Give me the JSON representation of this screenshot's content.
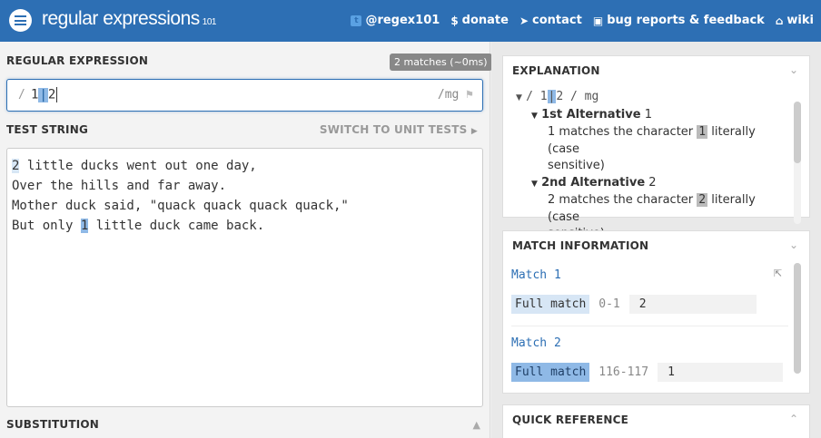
{
  "header": {
    "logo_main": "regular expressions",
    "logo_sub": "101",
    "nav": [
      {
        "icon": "twitter-icon",
        "label": "@regex101"
      },
      {
        "icon": "dollar-icon",
        "label": "donate"
      },
      {
        "icon": "paper-plane-icon",
        "label": "contact"
      },
      {
        "icon": "bug-icon",
        "label": "bug reports & feedback"
      },
      {
        "icon": "bank-icon",
        "label": "wiki"
      }
    ]
  },
  "regex_section": {
    "title": "REGULAR EXPRESSION",
    "badge": "2 matches (~0ms)",
    "delimiter_open": "/",
    "pattern_parts": [
      "1",
      "|",
      "2"
    ],
    "delimiter_close": "/",
    "flags": "mg"
  },
  "test_section": {
    "title": "TEST STRING",
    "switch_label": "SWITCH TO UNIT TESTS",
    "lines": [
      {
        "before": "",
        "match": "2",
        "after": " little ducks went out one day,"
      },
      {
        "text": "Over the hills and far away."
      },
      {
        "text": "Mother duck said, \"quack quack quack quack,\""
      },
      {
        "before": "But only ",
        "match": "1",
        "after": " little duck came back."
      }
    ]
  },
  "substitution": {
    "title": "SUBSTITUTION"
  },
  "explanation": {
    "title": "EXPLANATION",
    "root_prefix": "/ 1",
    "root_pipe": "|",
    "root_suffix": "2 / mg",
    "alt1_title": "1st Alternative",
    "alt1_value": "1",
    "alt1_desc_pre": "1 matches the character",
    "alt1_char": "1",
    "alt1_desc_post": "literally (case",
    "alt1_desc_end": "sensitive)",
    "alt2_title": "2nd Alternative",
    "alt2_value": "2",
    "alt2_desc_pre": "2 matches the character",
    "alt2_char": "2",
    "alt2_desc_post": "literally (case",
    "alt2_desc_end": "sensitive)"
  },
  "match_info": {
    "title": "MATCH INFORMATION",
    "matches": [
      {
        "label": "Match 1",
        "group": "Full match",
        "range": "0-1",
        "value": "2"
      },
      {
        "label": "Match 2",
        "group": "Full match",
        "range": "116-117",
        "value": "1"
      }
    ]
  },
  "quick_reference": {
    "title": "QUICK REFERENCE"
  }
}
